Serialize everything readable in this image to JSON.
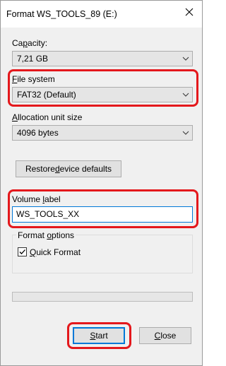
{
  "window": {
    "title": "Format WS_TOOLS_89 (E:)",
    "close_glyph": "close-icon"
  },
  "capacity": {
    "label_pre": "Ca",
    "label_key": "p",
    "label_post": "acity:",
    "value": "7,21 GB"
  },
  "file_system": {
    "label_key": "F",
    "label_post": "ile system",
    "value": "FAT32 (Default)"
  },
  "allocation": {
    "label_key": "A",
    "label_post": "llocation unit size",
    "value": "4096 bytes"
  },
  "restore_button": {
    "label_pre": "Restore ",
    "label_key": "d",
    "label_post": "evice defaults"
  },
  "volume_label": {
    "label_pre": "Volume ",
    "label_key": "l",
    "label_post": "abel",
    "value": "WS_TOOLS_XX"
  },
  "format_options": {
    "legend_pre": "Format ",
    "legend_key": "o",
    "legend_post": "ptions",
    "quick_format_key": "Q",
    "quick_format_post": "uick Format",
    "quick_format_checked": true
  },
  "progress": {
    "value": 0
  },
  "buttons": {
    "start_key": "S",
    "start_post": "tart",
    "close_key": "C",
    "close_post": "lose"
  },
  "colors": {
    "highlight": "#e4181c",
    "accent": "#0078d7",
    "dialog_bg": "#f0f0f0"
  }
}
